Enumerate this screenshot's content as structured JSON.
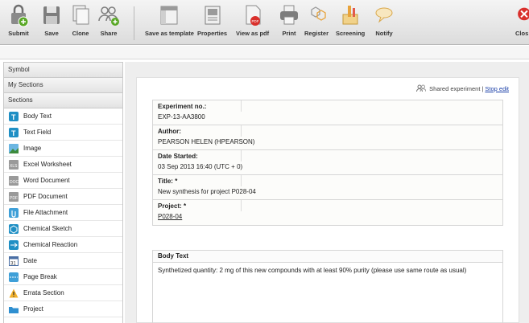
{
  "toolbar": {
    "buttons": [
      {
        "label": "Submit",
        "icon": "lock-submit-icon"
      },
      {
        "label": "Save",
        "icon": "floppy-disk-icon"
      },
      {
        "label": "Clone",
        "icon": "clone-document-icon"
      },
      {
        "label": "Share",
        "icon": "share-users-icon"
      },
      {
        "label": "Save as template",
        "icon": "template-icon"
      },
      {
        "label": "Properties",
        "icon": "properties-icon"
      },
      {
        "label": "View as pdf",
        "icon": "pdf-icon"
      },
      {
        "label": "Print",
        "icon": "printer-icon"
      },
      {
        "label": "Register",
        "icon": "register-icon"
      },
      {
        "label": "Screening",
        "icon": "screening-icon"
      },
      {
        "label": "Notify",
        "icon": "notify-bubble-icon"
      },
      {
        "label": "Clos",
        "icon": "close-icon"
      }
    ]
  },
  "sidebar": {
    "headers": [
      "Symbol",
      "My Sections",
      "Sections"
    ],
    "items": [
      {
        "label": "Body Text",
        "icon": "body-text-icon"
      },
      {
        "label": "Text Field",
        "icon": "text-field-icon"
      },
      {
        "label": "Image",
        "icon": "image-icon"
      },
      {
        "label": "Excel Worksheet",
        "icon": "excel-worksheet-icon"
      },
      {
        "label": "Word Document",
        "icon": "word-document-icon"
      },
      {
        "label": "PDF Document",
        "icon": "pdf-document-icon"
      },
      {
        "label": "File Attachment",
        "icon": "file-attachment-icon"
      },
      {
        "label": "Chemical Sketch",
        "icon": "chemical-sketch-icon"
      },
      {
        "label": "Chemical Reaction",
        "icon": "chemical-reaction-icon"
      },
      {
        "label": "Date",
        "icon": "calendar-date-icon"
      },
      {
        "label": "Page Break",
        "icon": "page-break-icon"
      },
      {
        "label": "Errata Section",
        "icon": "warning-icon"
      },
      {
        "label": "Project",
        "icon": "folder-icon"
      }
    ]
  },
  "experiment": {
    "shared_label": "Shared experiment",
    "separator": "|",
    "stop_edit": "Stop edit",
    "fields": [
      {
        "key": "Experiment no.:",
        "value": "EXP-13-AA3800"
      },
      {
        "key": "Author:",
        "value": "PEARSON HELEN (HPEARSON)"
      },
      {
        "key": "Date Started:",
        "value": "03 Sep 2013 16:40 (UTC + 0)"
      },
      {
        "key": "Title: *",
        "value": "New synthesis for project P028-04"
      },
      {
        "key": "Project: *",
        "value": "P028-04"
      }
    ],
    "body_text": {
      "header": "Body Text",
      "content": "Synthetized quantity: 2 mg of this new compounds with at least 90% purity (please use same route as usual)"
    }
  },
  "colors": {
    "accent_blue": "#1a3fa8",
    "close_red": "#d9302c",
    "sidebar_icon_teal": "#1f8fc4"
  }
}
